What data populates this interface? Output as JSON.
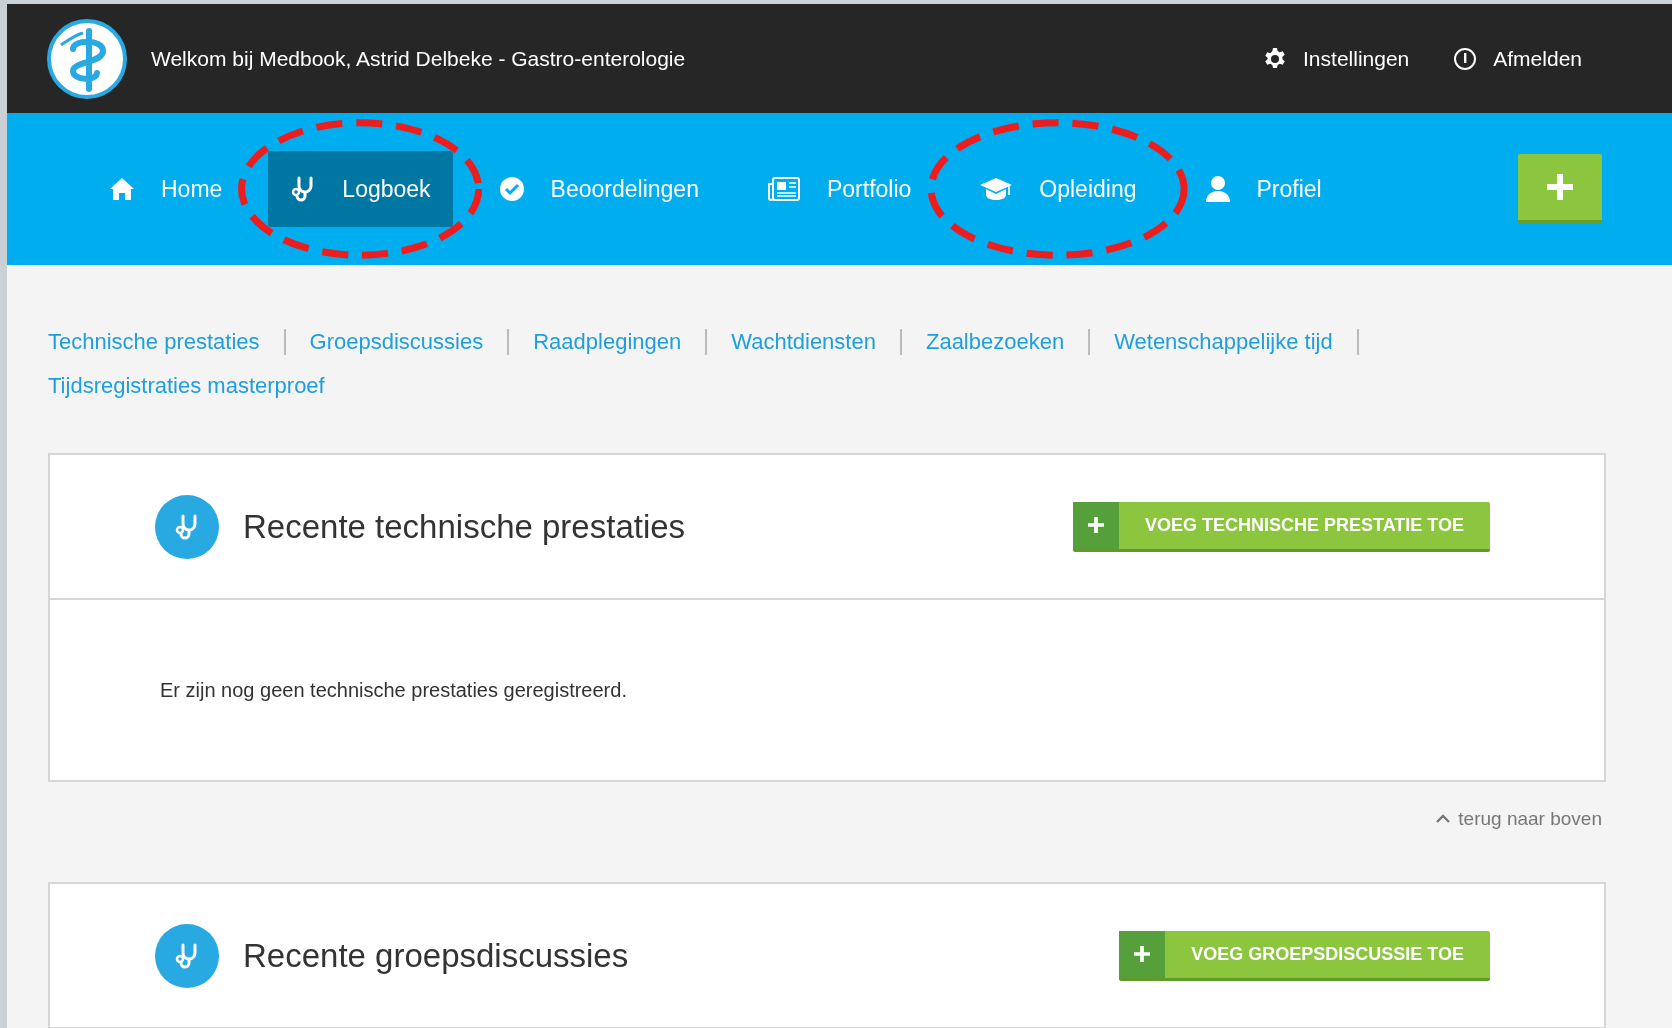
{
  "header": {
    "welcome": "Welkom bij Medbook, Astrid Delbeke - Gastro-enterologie",
    "links": [
      {
        "kind": "settings",
        "label": "Instellingen"
      },
      {
        "kind": "logout",
        "label": "Afmelden"
      }
    ]
  },
  "nav": {
    "items": [
      {
        "kind": "home",
        "label": "Home",
        "selected": false,
        "circled": false
      },
      {
        "kind": "stethoscope",
        "label": "Logboek",
        "selected": true,
        "circled": true
      },
      {
        "kind": "check",
        "label": "Beoordelingen",
        "selected": false,
        "circled": false
      },
      {
        "kind": "news",
        "label": "Portfolio",
        "selected": false,
        "circled": false
      },
      {
        "kind": "cap",
        "label": "Opleiding",
        "selected": false,
        "circled": true
      },
      {
        "kind": "person",
        "label": "Profiel",
        "selected": false,
        "circled": false
      }
    ]
  },
  "sub_links": [
    "Technische prestaties",
    "Groepsdiscussies",
    "Raadplegingen",
    "Wachtdiensten",
    "Zaalbezoeken",
    "Wetenschappelijke tijd",
    "Tijdsregistraties masterproef"
  ],
  "sections": [
    {
      "title": "Recente technische prestaties",
      "button": "VOEG TECHNISCHE PRESTATIE TOE",
      "empty_text": "Er zijn nog geen technische prestaties geregistreerd.",
      "back_to_top": "terug naar boven"
    },
    {
      "title": "Recente groepsdiscussies",
      "button": "VOEG GROEPSDISCUSSIE TOE"
    }
  ]
}
